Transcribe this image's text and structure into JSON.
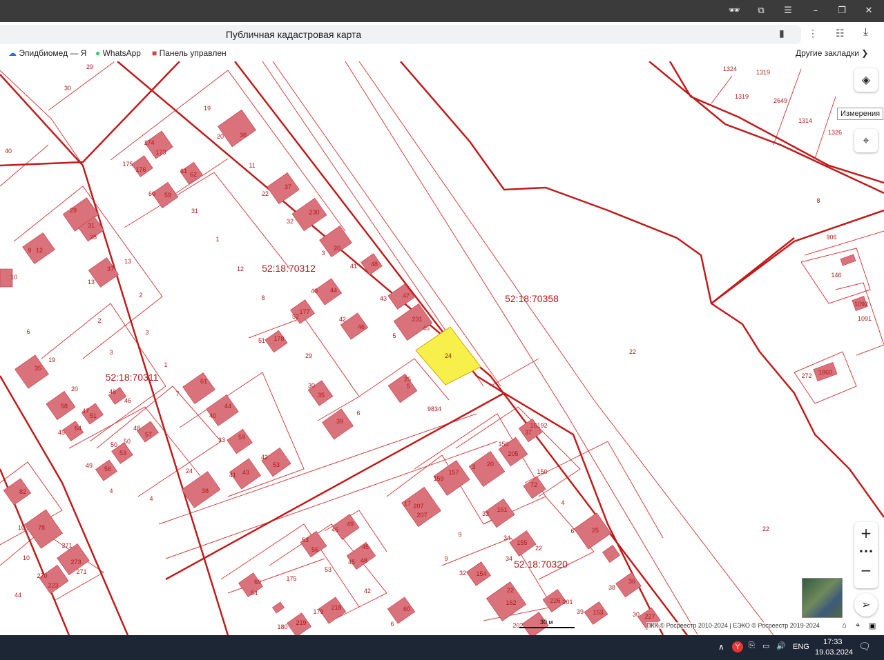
{
  "browser": {
    "page_title": "Публичная кадастровая карта",
    "bookmarks": [
      "Эпидбиомед — Я",
      "WhatsApp",
      "Панель управлен"
    ],
    "other_bookmarks": "Другие закладки"
  },
  "map": {
    "blocks": [
      "52:18:70312",
      "52:18:70311",
      "52:18:70358",
      "52:18:70320"
    ],
    "highlighted_parcel": "24",
    "tooltip": "Измерения",
    "scale": "30 м",
    "attribution": "ПКК © Росреестр 2010-2024 | ЕЭКО © Росреестр 2019-2024",
    "labels": [
      [
        "29",
        130,
        100
      ],
      [
        "30",
        98,
        131
      ],
      [
        "19",
        300,
        160
      ],
      [
        "20",
        319,
        201
      ],
      [
        "36",
        352,
        199
      ],
      [
        "174",
        216,
        210
      ],
      [
        "173",
        233,
        224
      ],
      [
        "175",
        185,
        241
      ],
      [
        "176",
        204,
        249
      ],
      [
        "61",
        266,
        251
      ],
      [
        "62",
        280,
        256
      ],
      [
        "11",
        365,
        243
      ],
      [
        "40",
        12,
        222
      ],
      [
        "60",
        220,
        284
      ],
      [
        "59",
        243,
        286
      ],
      [
        "22",
        384,
        284
      ],
      [
        "37",
        417,
        274
      ],
      [
        "31",
        282,
        309
      ],
      [
        "32",
        420,
        324
      ],
      [
        "230",
        455,
        311
      ],
      [
        "29",
        106,
        308
      ],
      [
        "31",
        132,
        330
      ],
      [
        "28",
        135,
        347
      ],
      [
        "1",
        315,
        350
      ],
      [
        "12",
        348,
        393
      ],
      [
        "3",
        468,
        370
      ],
      [
        "20",
        488,
        363
      ],
      [
        "41",
        512,
        389
      ],
      [
        "48",
        542,
        386
      ],
      [
        "9",
        43,
        366
      ],
      [
        "12",
        57,
        366
      ],
      [
        "10",
        20,
        405
      ],
      [
        "13",
        185,
        382
      ],
      [
        "13",
        132,
        412
      ],
      [
        "37",
        160,
        393
      ],
      [
        "8",
        381,
        435
      ],
      [
        "40",
        455,
        425
      ],
      [
        "44",
        483,
        424
      ],
      [
        "43",
        555,
        436
      ],
      [
        "47",
        588,
        432
      ],
      [
        "2",
        204,
        431
      ],
      [
        "52",
        428,
        462
      ],
      [
        "177",
        441,
        455
      ],
      [
        "42",
        496,
        466
      ],
      [
        "46",
        523,
        477
      ],
      [
        "231",
        604,
        466
      ],
      [
        "45",
        617,
        479
      ],
      [
        "2",
        144,
        468
      ],
      [
        "6",
        41,
        484
      ],
      [
        "3",
        213,
        485
      ],
      [
        "5",
        571,
        490
      ],
      [
        "51",
        379,
        497
      ],
      [
        "178",
        404,
        494
      ],
      [
        "29",
        447,
        519
      ],
      [
        "3",
        161,
        514
      ],
      [
        "1",
        240,
        532
      ],
      [
        "19",
        75,
        525
      ],
      [
        "35",
        55,
        537
      ],
      [
        "7",
        257,
        574
      ],
      [
        "61",
        295,
        556
      ],
      [
        "30",
        451,
        562
      ],
      [
        "35",
        465,
        576
      ],
      [
        "25",
        590,
        553
      ],
      [
        "5",
        591,
        563
      ],
      [
        "20",
        108,
        567
      ],
      [
        "58",
        93,
        592
      ],
      [
        "46",
        163,
        571
      ],
      [
        "46",
        185,
        584
      ],
      [
        "47",
        124,
        599
      ],
      [
        "51",
        135,
        606
      ],
      [
        "9834",
        629,
        596
      ],
      [
        "6",
        519,
        602
      ],
      [
        "40",
        308,
        606
      ],
      [
        "44",
        330,
        592
      ],
      [
        "45",
        89,
        630
      ],
      [
        "64",
        113,
        624
      ],
      [
        "48",
        198,
        624
      ],
      [
        "57",
        215,
        633
      ],
      [
        "33",
        321,
        641
      ],
      [
        "59",
        350,
        637
      ],
      [
        "39",
        492,
        614
      ],
      [
        "50",
        165,
        648
      ],
      [
        "53",
        178,
        660
      ],
      [
        "50",
        184,
        643
      ],
      [
        "42",
        383,
        666
      ],
      [
        "53",
        400,
        677
      ],
      [
        "49",
        129,
        678
      ],
      [
        "56",
        156,
        683
      ],
      [
        "41",
        337,
        692
      ],
      [
        "43",
        356,
        688
      ],
      [
        "24",
        274,
        686
      ],
      [
        "38",
        297,
        715
      ],
      [
        "4",
        161,
        715
      ],
      [
        "4",
        219,
        726
      ],
      [
        "10",
        31,
        768
      ],
      [
        "78",
        60,
        768
      ],
      [
        "82",
        33,
        716
      ],
      [
        "271",
        97,
        794
      ],
      [
        "273",
        110,
        818
      ],
      [
        "271",
        118,
        832
      ],
      [
        "270",
        61,
        838
      ],
      [
        "223",
        77,
        852
      ],
      [
        "44",
        26,
        866
      ],
      [
        "10",
        38,
        812
      ],
      [
        "156",
        729,
        647
      ],
      [
        "205",
        743,
        661
      ],
      [
        "15192",
        780,
        620
      ],
      [
        "37",
        765,
        630
      ],
      [
        "159",
        635,
        697
      ],
      [
        "157",
        657,
        688
      ],
      [
        "3",
        686,
        680
      ],
      [
        "20",
        710,
        676
      ],
      [
        "150",
        785,
        687
      ],
      [
        "72",
        773,
        706
      ],
      [
        "17",
        590,
        733
      ],
      [
        "207",
        606,
        737
      ],
      [
        "207",
        611,
        750
      ],
      [
        "33",
        703,
        748
      ],
      [
        "161",
        727,
        742
      ],
      [
        "4",
        815,
        732
      ],
      [
        "6",
        829,
        773
      ],
      [
        "25",
        862,
        772
      ],
      [
        "9",
        666,
        778
      ],
      [
        "34",
        734,
        783
      ],
      [
        "155",
        756,
        790
      ],
      [
        "9",
        646,
        813
      ],
      [
        "34",
        737,
        813
      ],
      [
        "22",
        780,
        798
      ],
      [
        "32",
        670,
        834
      ],
      [
        "154",
        697,
        835
      ],
      [
        "38",
        886,
        855
      ],
      [
        "36",
        915,
        846
      ],
      [
        "22",
        739,
        859
      ],
      [
        "162",
        740,
        877
      ],
      [
        "226",
        804,
        874
      ],
      [
        "201",
        822,
        876
      ],
      [
        "39",
        840,
        890
      ],
      [
        "153",
        866,
        891
      ],
      [
        "30",
        921,
        894
      ],
      [
        "227",
        941,
        897
      ],
      [
        "202",
        750,
        910
      ],
      [
        "53",
        442,
        786
      ],
      [
        "56",
        456,
        800
      ],
      [
        "46",
        485,
        771
      ],
      [
        "49",
        507,
        763
      ],
      [
        "45",
        529,
        796
      ],
      [
        "48",
        527,
        816
      ],
      [
        "45",
        509,
        818
      ],
      [
        "53",
        475,
        829
      ],
      [
        "175",
        422,
        842
      ],
      [
        "69",
        373,
        847
      ],
      [
        "54",
        368,
        863
      ],
      [
        "42",
        532,
        860
      ],
      [
        "60",
        589,
        886
      ],
      [
        "179",
        461,
        890
      ],
      [
        "218",
        487,
        884
      ],
      [
        "180",
        409,
        912
      ],
      [
        "219",
        436,
        906
      ],
      [
        "6",
        568,
        908
      ],
      [
        "1324",
        1057,
        103
      ],
      [
        "1319",
        1105,
        108
      ],
      [
        "1319",
        1074,
        143
      ],
      [
        "2649",
        1130,
        149
      ],
      [
        "1314",
        1166,
        178
      ],
      [
        "1326",
        1209,
        195
      ],
      [
        "8",
        1185,
        294
      ],
      [
        "906",
        1204,
        347
      ],
      [
        "146",
        1211,
        402
      ],
      [
        "1092",
        1247,
        444
      ],
      [
        "1091",
        1252,
        465
      ],
      [
        "272",
        1168,
        548
      ],
      [
        "1860",
        1195,
        543
      ],
      [
        "22",
        916,
        513
      ],
      [
        "22",
        1109,
        770
      ],
      [
        "8",
        758,
        89
      ]
    ]
  },
  "taskbar": {
    "lang": "ENG",
    "time": "17:33",
    "date": "19.03.2024"
  }
}
